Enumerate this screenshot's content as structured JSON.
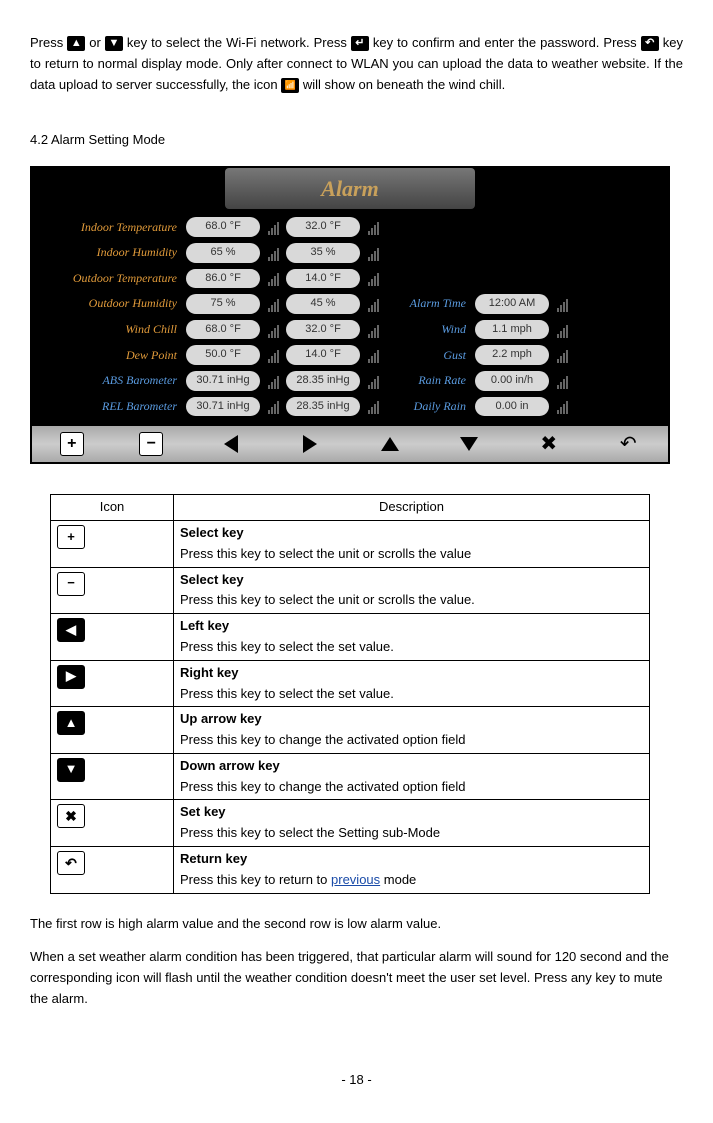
{
  "intro": {
    "t1": "Press ",
    "t2": " or ",
    "t3": " key to select the Wi-Fi network. Press ",
    "t4": " key to confirm and enter the password. Press ",
    "t5": " key to return to normal display mode. Only after connect to WLAN you can upload the data to weather website. If the data upload to server successfully, the icon ",
    "t6": " will show on beneath the wind chill."
  },
  "section_heading": "4.2   Alarm Setting Mode",
  "alarm": {
    "title": "Alarm",
    "rows": [
      {
        "label": "Indoor Temperature",
        "cls": "orange",
        "v1": "68.0 °F",
        "v2": "32.0 °F"
      },
      {
        "label": "Indoor Humidity",
        "cls": "orange",
        "v1": "65 %",
        "v2": "35 %"
      },
      {
        "label": "Outdoor Temperature",
        "cls": "orange",
        "v1": "86.0 °F",
        "v2": "14.0 °F"
      },
      {
        "label": "Outdoor Humidity",
        "cls": "orange",
        "v1": "75 %",
        "v2": "45 %",
        "right_label": "Alarm Time",
        "right_cls": "blue",
        "rv": "12:00 AM"
      },
      {
        "label": "Wind Chill",
        "cls": "orange",
        "v1": "68.0 °F",
        "v2": "32.0 °F",
        "right_label": "Wind",
        "right_cls": "blue",
        "rv": "1.1 mph"
      },
      {
        "label": "Dew Point",
        "cls": "orange",
        "v1": "50.0 °F",
        "v2": "14.0 °F",
        "right_label": "Gust",
        "right_cls": "blue",
        "rv": "2.2 mph"
      },
      {
        "label": "ABS Barometer",
        "cls": "blue",
        "v1": "30.71 inHg",
        "v2": "28.35 inHg",
        "right_label": "Rain Rate",
        "right_cls": "blue",
        "rv": "0.00 in/h"
      },
      {
        "label": "REL Barometer",
        "cls": "blue",
        "v1": "30.71 inHg",
        "v2": "28.35 inHg",
        "right_label": "Daily Rain",
        "right_cls": "blue",
        "rv": "0.00 in"
      }
    ]
  },
  "table": {
    "headers": {
      "c1": "Icon",
      "c2": "Description"
    },
    "rows": [
      {
        "title": "Select key",
        "text": "Press this key to select the unit or scrolls the value",
        "icon": "plus"
      },
      {
        "title": "Select key",
        "text": "Press this key to select the unit or scrolls the value.",
        "icon": "minus"
      },
      {
        "title": "Left key",
        "text": "Press this key to select the set value.",
        "icon": "left"
      },
      {
        "title": "Right key",
        "text": "Press this key to select the set value.",
        "icon": "right"
      },
      {
        "title": "Up arrow key",
        "text": "Press this key to change the activated option field",
        "icon": "up"
      },
      {
        "title": "Down arrow key",
        "text": "Press this key to change the activated option field",
        "icon": "down"
      },
      {
        "title": "Set key",
        "text": "Press this key to select the Setting sub-Mode",
        "icon": "set"
      },
      {
        "title": "Return key",
        "text_pre": "Press this key to return to ",
        "link": "previous",
        "text_post": " mode",
        "icon": "return"
      }
    ]
  },
  "outro": {
    "p1": "The first row is high alarm value and the second row is low alarm value.",
    "p2": "When a set weather alarm condition has been triggered, that particular alarm will sound for 120 second and the corresponding icon will flash until the weather condition doesn't meet the user set level. Press any key to mute the alarm."
  },
  "footer": "- 18 -"
}
